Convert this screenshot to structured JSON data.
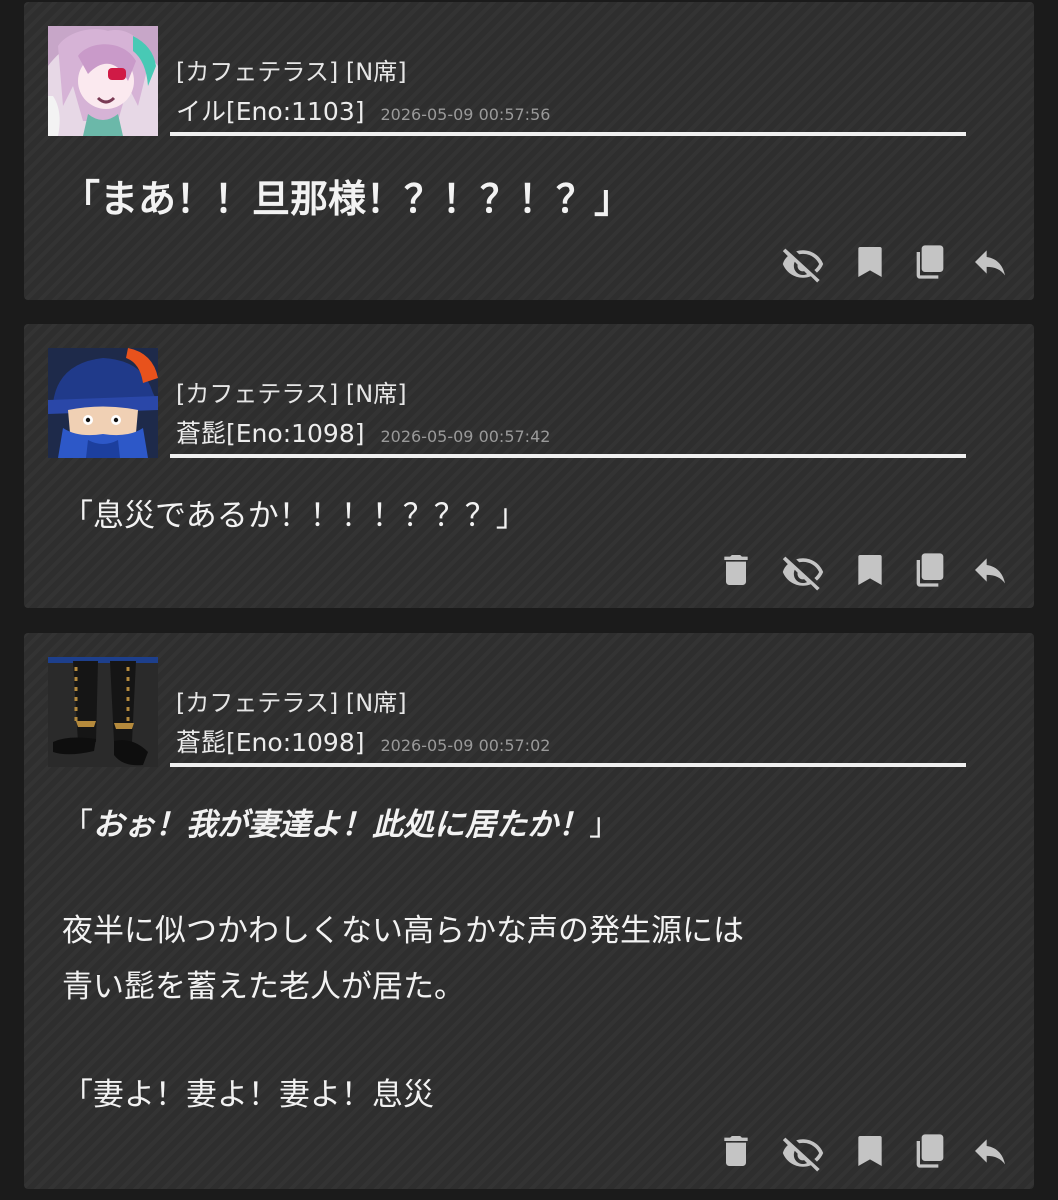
{
  "posts": [
    {
      "location": "[カフェテラス] [N席]",
      "name": "イル[Eno:1103]",
      "timestamp": "2026-05-09 00:57:56",
      "message": "「まあ！！旦那様！？！？！？」",
      "avatar_desc": "pink-haired character"
    },
    {
      "location": "[カフェテラス] [N席]",
      "name": "蒼髭[Eno:1098]",
      "timestamp": "2026-05-09 00:57:42",
      "message": "「息災であるか！！！！？？？」",
      "avatar_desc": "blue-bearded man with hat"
    },
    {
      "location": "[カフェテラス] [N席]",
      "name": "蒼髭[Eno:1098]",
      "timestamp": "2026-05-09 00:57:02",
      "quote_open": "「",
      "quote_em": "おぉ！我が妻達よ！此処に居たか！",
      "quote_close": "」",
      "paragraph": "夜半に似つかわしくない高らかな声の発生源には\n青い髭を蓄えた老人が居た。",
      "last_line": "「妻よ！妻よ！妻よ！息災",
      "avatar_desc": "legs in dark boots"
    }
  ],
  "icons": [
    "delete-icon",
    "hide-icon",
    "bookmark-icon",
    "copy-icon",
    "reply-icon"
  ],
  "colors": {
    "background": "#1b1b1b",
    "card": "#2e2e2e",
    "icon": "#c4c4c4",
    "timestamp": "#9a9a9a"
  }
}
